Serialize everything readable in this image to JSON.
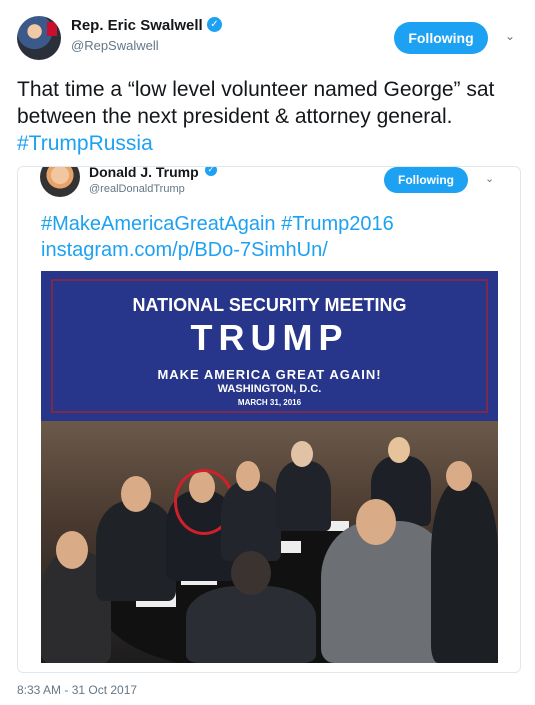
{
  "author": {
    "name": "Rep. Eric Swalwell",
    "handle": "@RepSwalwell",
    "follow_label": "Following"
  },
  "tweet": {
    "text_main": "That time a “low level volunteer named George” sat between the next president & attorney general.",
    "hashtag": "#TrumpRussia",
    "timestamp": "8:33 AM - 31 Oct 2017"
  },
  "embedded": {
    "name": "Donald J. Trump",
    "handle": "@realDonaldTrump",
    "follow_label": "Following",
    "text_line1": "#MakeAmericaGreatAgain #Trump2016",
    "text_line2": "instagram.com/p/BDo-7SimhUn/"
  },
  "photo_banner": {
    "line1": "NATIONAL SECURITY MEETING",
    "line2": "TRUMP",
    "line3": "MAKE AMERICA GREAT AGAIN!",
    "line4": "WASHINGTON, D.C.",
    "line5": "MARCH 31, 2016"
  },
  "colors": {
    "accent": "#1da1f2",
    "banner": "#27358a",
    "highlight_circle": "#d0202a"
  },
  "icons": [
    "verified-badge-icon",
    "chevron-down-icon"
  ]
}
